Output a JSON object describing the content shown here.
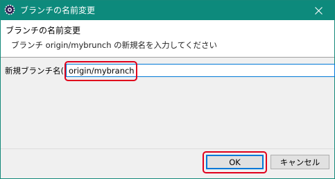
{
  "dialog": {
    "window_title": "ブランチの名前変更",
    "header_title": "ブランチの名前変更",
    "description": "ブランチ origin/mybrunch の新規名を入力してください",
    "field_label": "新規ブランチ名(N):",
    "field_value": "origin/mybranch",
    "ok_label": "OK",
    "cancel_label": "キャンセル"
  },
  "icons": {
    "app": "eclipse-gear-icon",
    "close": "close-icon"
  },
  "colors": {
    "titlebar": "#0d8a7c",
    "focus_border": "#0078d7",
    "highlight_annotation": "#e0001b"
  }
}
